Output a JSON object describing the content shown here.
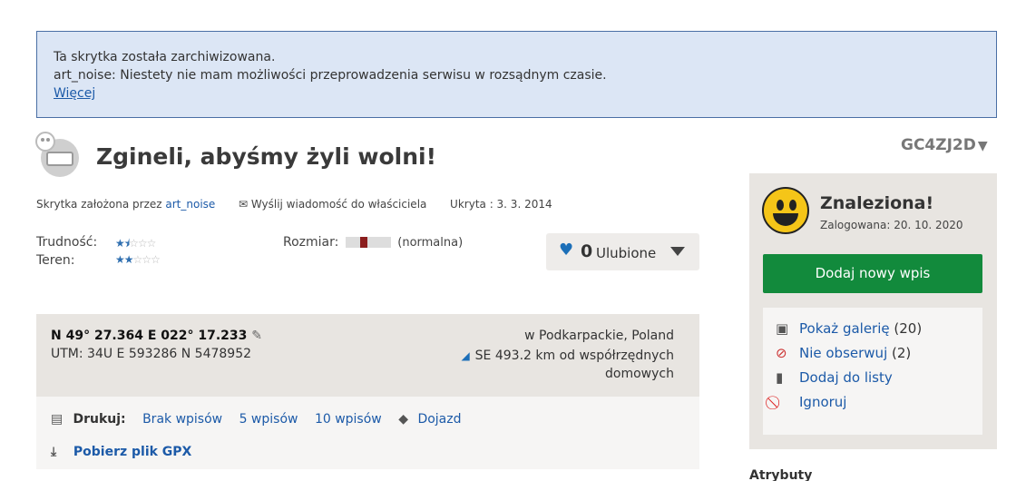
{
  "notice": {
    "line1": "Ta skrytka została zarchiwizowana.",
    "line2": "art_noise: Niestety nie mam możliwości przeprowadzenia serwisu w rozsądnym czasie.",
    "more_link": "Więcej"
  },
  "cache": {
    "title": "Zgineli, abyśmy żyli wolni!",
    "code": "GC4ZJ2D",
    "created_by_label": "Skrytka założona przez",
    "owner": "art_noise",
    "message_link": "Wyślij wiadomość do właściciela",
    "hidden": "Ukryta : 3. 3. 2014",
    "difficulty_label": "Trudność:",
    "difficulty": 1.5,
    "terrain_label": "Teren:",
    "terrain": 2,
    "size_label": "Rozmiar:",
    "size_text": "(normalna)"
  },
  "favorites": {
    "count": "0",
    "label": "Ulubione"
  },
  "coords": {
    "latlon": "N 49° 27.364 E 022° 17.233",
    "utm": "UTM: 34U E 593286 N 5478952",
    "location": "w Podkarpackie, Poland",
    "distance": "SE 493.2 km od współrzędnych domowych"
  },
  "print": {
    "label": "Drukuj:",
    "options": [
      "Brak wpisów",
      "5 wpisów",
      "10 wpisów",
      "Dojazd"
    ],
    "gpx": "Pobierz plik GPX"
  },
  "sidebar": {
    "status": "Znaleziona!",
    "logged": "Zalogowana: 20. 10. 2020",
    "add_log": "Dodaj nowy wpis",
    "gallery": "Pokaż galerię",
    "gallery_count": "(20)",
    "unwatch": "Nie obserwuj",
    "unwatch_count": "(2)",
    "add_list": "Dodaj do listy",
    "ignore": "Ignoruj",
    "attributes": "Atrybuty"
  },
  "colors": {
    "link": "#1c5aa8",
    "button": "#128a3c",
    "notice_bg": "#dce6f5"
  }
}
